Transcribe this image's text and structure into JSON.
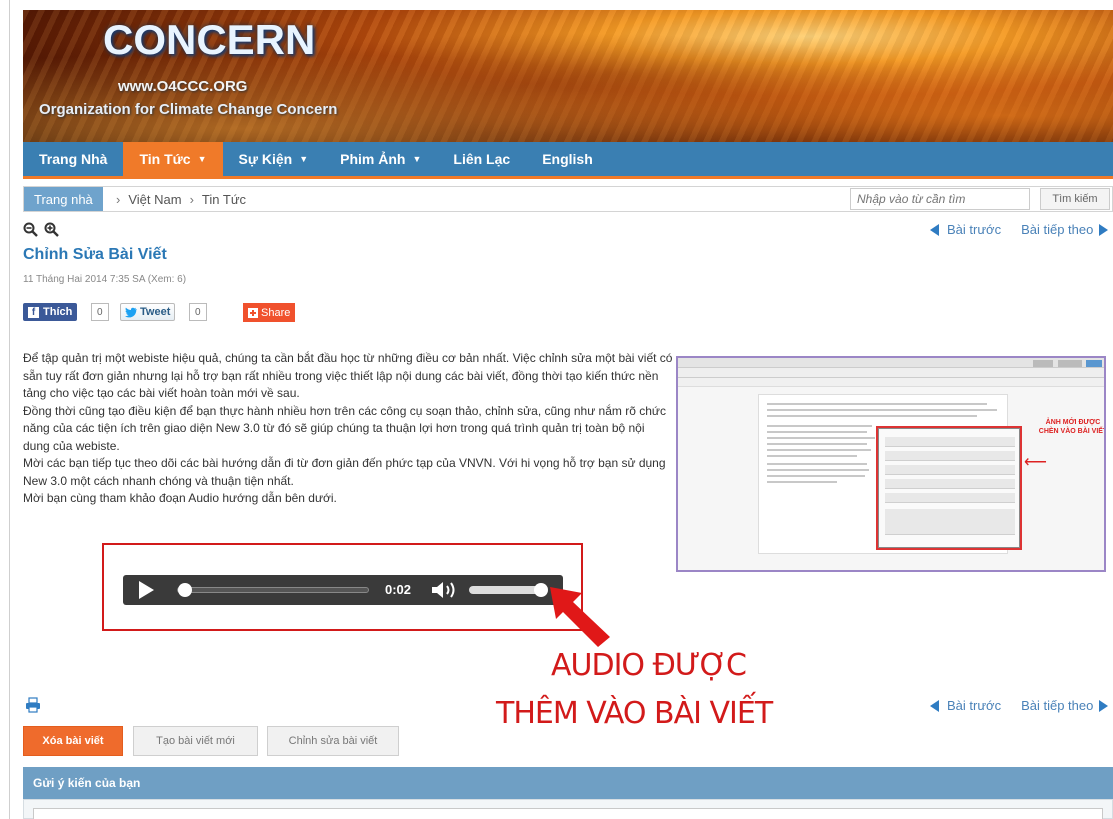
{
  "banner": {
    "logo": "CONCERN",
    "url": "www.O4CCC.ORG",
    "org": "Organization for Climate Change Concern"
  },
  "nav": {
    "items": [
      {
        "label": "Trang Nhà",
        "active": false,
        "dropdown": false
      },
      {
        "label": "Tin Tức",
        "active": true,
        "dropdown": true
      },
      {
        "label": "Sự Kiện",
        "active": false,
        "dropdown": true
      },
      {
        "label": "Phim Ảnh",
        "active": false,
        "dropdown": true
      },
      {
        "label": "Liên Lạc",
        "active": false,
        "dropdown": false
      },
      {
        "label": "English",
        "active": false,
        "dropdown": false
      }
    ]
  },
  "breadcrumb": {
    "home": "Trang nhà",
    "items": [
      "Việt Nam",
      "Tin Tức"
    ],
    "separator": "›"
  },
  "search": {
    "placeholder": "Nhập vào từ cần tìm",
    "button": "Tìm kiếm"
  },
  "pager": {
    "prev": "Bài trước",
    "next": "Bài tiếp theo"
  },
  "article": {
    "title": "Chỉnh Sửa Bài Viết",
    "meta": "11 Tháng Hai 2014  7:35 SA  (Xem: 6)",
    "paragraphs": [
      "Để tập quản trị một webiste hiệu quả, chúng ta cần bắt đầu học từ những điều cơ bản nhất. Việc chỉnh sửa một bài viết có sẵn tuy rất đơn giản nhưng lại hỗ trợ bạn rất nhiều trong việc thiết lập nội dung các bài viết, đồng thời tạo kiến thức nền tảng cho việc tạo các bài viết hoàn toàn mới về sau.",
      "Đồng thời cũng tạo điều kiện để bạn thực hành nhiều hơn trên các công cụ soạn thảo, chỉnh sửa, cũng như nắm rõ chức năng của các tiện ích trên giao diện New 3.0 từ đó sẽ giúp chúng ta thuận lợi hơn trong quá trình quản trị toàn bộ nội dung của webiste.",
      "Mời các bạn tiếp tục theo dõi các bài hướng dẫn đi từ đơn giản đến phức tạp của VNVN. Với hi vọng hỗ trợ bạn sử dụng New 3.0 một cách nhanh chóng và thuận tiện nhất.",
      "Mời bạn cùng tham khảo đoạn Audio hướng dẫn bên dưới."
    ]
  },
  "social": {
    "like_label": "Thích",
    "like_count": "0",
    "tweet_label": "Tweet",
    "tweet_count": "0",
    "share_label": "Share"
  },
  "thumbnail": {
    "note": "ẢNH MỚI ĐƯỢC CHÈN VÀO BÀI VIẾT"
  },
  "player": {
    "time": "0:02",
    "progress": 0.04,
    "volume": 0.95
  },
  "annotation": {
    "line1": "AUDIO ĐƯỢC",
    "line2": "THÊM VÀO BÀI VIẾT",
    "color": "#d21a1a"
  },
  "actions": {
    "delete": "Xóa bài viết",
    "new": "Tạo bài viết mới",
    "edit": "Chỉnh sửa bài viết"
  },
  "comments": {
    "header": "Gửi ý kiến của bạn"
  },
  "colors": {
    "nav_bg": "#3a7fb2",
    "nav_active": "#f07a29",
    "link": "#2b78b5",
    "delete_btn": "#ef6b2c"
  }
}
